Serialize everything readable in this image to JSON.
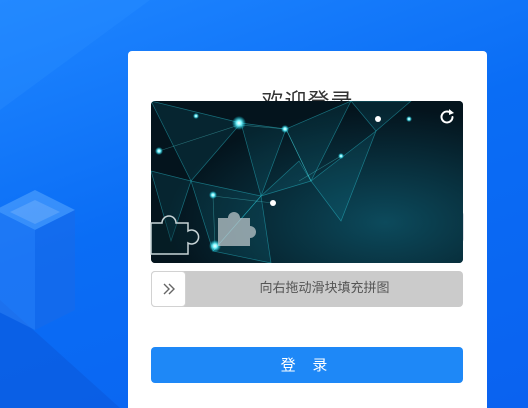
{
  "page": {
    "background_color": "#0a6df5",
    "card_color": "#ffffff"
  },
  "login": {
    "title": "欢迎登录",
    "button_label": "登 录",
    "button_color": "#1e88f7"
  },
  "captcha": {
    "slider_hint": "向右拖动滑块填充拼图",
    "handle_icon": "double-chevron-right-icon",
    "refresh_icon": "refresh-icon"
  }
}
